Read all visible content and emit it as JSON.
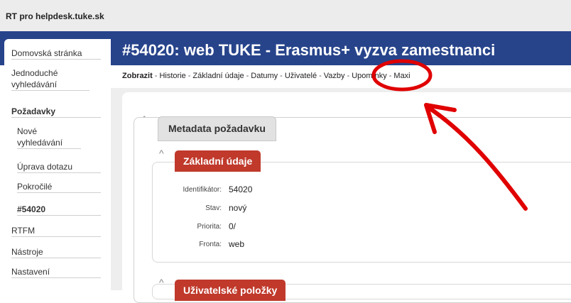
{
  "app": {
    "title": "RT pro helpdesk.tuke.sk"
  },
  "ticket": {
    "title": "#54020: web TUKE - Erasmus+ vyzva zamestnanci"
  },
  "sidebar": {
    "items": [
      {
        "label": "Domovská stránka"
      },
      {
        "label": "Jednoduché vyhledávání"
      },
      {
        "label": "Požadavky"
      },
      {
        "label": "Nové vyhledávání"
      },
      {
        "label": "Úprava dotazu"
      },
      {
        "label": "Pokročilé"
      },
      {
        "label": "#54020"
      },
      {
        "label": "RTFM"
      },
      {
        "label": "Nástroje"
      },
      {
        "label": "Nastavení"
      }
    ]
  },
  "nav": {
    "links": [
      "Zobrazit",
      "Historie",
      "Základní údaje",
      "Datumy",
      "Uživatelé",
      "Vazby",
      "Upomínky",
      "Maxi"
    ],
    "separator": "-"
  },
  "panels": {
    "metadata_title": "Metadata požadavku",
    "basic_title": "Základní údaje",
    "user_fields_title": "Uživatelské položky",
    "collapse_glyph": "^"
  },
  "fields": [
    {
      "label": "Identifikátor:",
      "value": "54020"
    },
    {
      "label": "Stav:",
      "value": "nový"
    },
    {
      "label": "Priorita:",
      "value": "0/"
    },
    {
      "label": "Fronta:",
      "value": "web"
    }
  ],
  "colors": {
    "header": "#27448b",
    "tab_red": "#c0392b",
    "annotation_red": "#e00000"
  }
}
